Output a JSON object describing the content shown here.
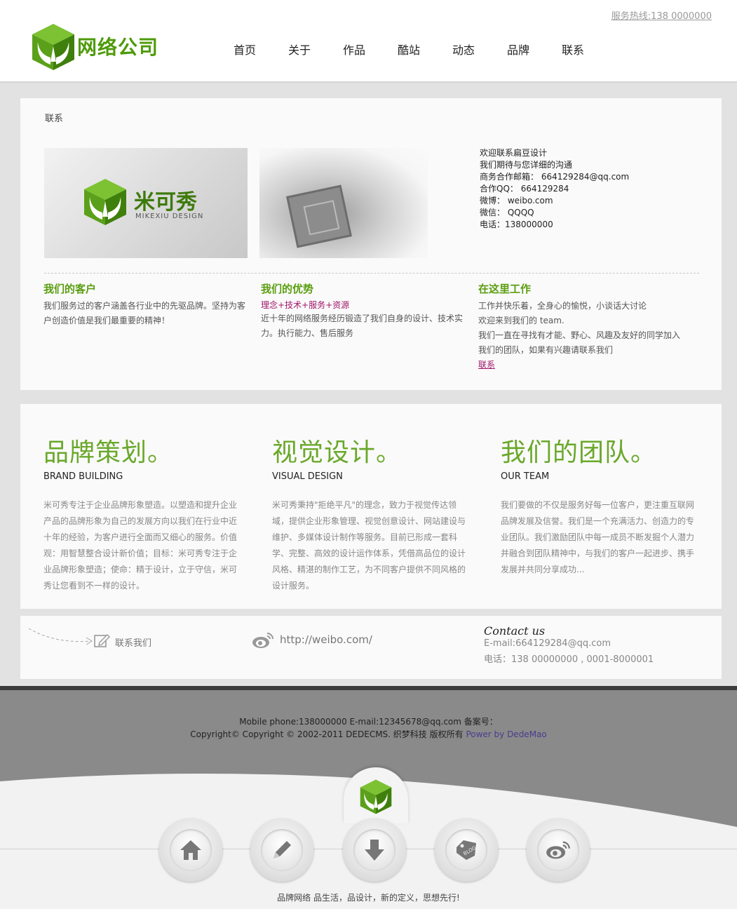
{
  "header": {
    "hotline": "服务热线:138 0000000",
    "logo_text": "网络公司",
    "nav": [
      "首页",
      "关于",
      "作品",
      "酷站",
      "动态",
      "品牌",
      "联系"
    ]
  },
  "contact": {
    "breadcrumb": "联系",
    "logo_name": "米可秀",
    "logo_sub": "MIKEXIU DESIGN",
    "info": [
      "欢迎联系扁豆设计",
      "我们期待与您详细的沟通",
      "商务合作邮箱： 664129284@qq.com",
      "合作QQ： 664129284",
      "微博： weibo.com",
      "微信： QQQQ",
      "电话：138000000"
    ],
    "col1": {
      "title": "我们的客户",
      "text": "我们服务过的客户涵盖各行业中的先驱品牌。坚持为客户创造价值是我们最重要的精神！"
    },
    "col2": {
      "title": "我们的优势",
      "highlight": "理念+技术+服务+资源",
      "text": "近十年的网络服务经历锻造了我们自身的设计、技术实力。执行能力、售后服务"
    },
    "col3": {
      "title": "在这里工作",
      "line1": "工作并快乐着，全身心的愉悦，小谈话大讨论",
      "line2": "欢迎来到我们的 team.",
      "line3": "我们一直在寻找有才能、野心、风趣及友好的同学加入我们的团队，如果有兴趣请联系我们",
      "link": "联系"
    }
  },
  "services": [
    {
      "title": "品牌策划。",
      "en": "BRAND BUILDING",
      "text": "米可秀专注于企业品牌形象塑造。以塑造和提升企业产品的品牌形象为自己的发展方向以我们在行业中近十年的经验，为客户进行全面而又细心的服务。价值观：用智慧整合设计新价值；目标：米可秀专注于企业品牌形象塑造；使命：精于设计，立于守信，米可秀让您看到不一样的设计。"
    },
    {
      "title": "视觉设计。",
      "en": "VISUAL DESIGN",
      "text": "米可秀秉持\"拒绝平凡\"的理念，致力于视觉传达领域，提供企业形象管理、视觉创意设计、网站建设与维护、多媒体设计制作等服务。目前已形成一套科学、完整、高效的设计运作体系，凭借高品位的设计风格、精湛的制作工艺，为不同客户提供不同风格的设计服务。"
    },
    {
      "title": "我们的团队。",
      "en": "OUR TEAM",
      "text": "我们要做的不仅是服务好每一位客户，更注重互联网品牌发展及信誉。我们是一个充满活力、创造力的专业团队。我们激励团队中每一成员不断发掘个人潜力并融合到团队精神中，与我们的客户一起进步、携手发展并共同分享成功..."
    }
  ],
  "strip": {
    "contact_link": "联系我们",
    "weibo_url": "http://weibo.com/",
    "contact_title": "Contact us",
    "email": "E-mail:664129284@qq.com",
    "phone": "电话：138 00000000 , 0001-8000001"
  },
  "footer": {
    "line1": "Mobile phone:138000000  E-mail:12345678@qq.com  备案号：",
    "line2": "Copyright© Copyright © 2002-2011 DEDECMS. 织梦科技 版权所有 ",
    "power": "Power by DedeMao",
    "icons": [
      "home-icon",
      "pencil-icon",
      "download-icon",
      "blog-tag-icon",
      "weibo-icon"
    ],
    "slogan": "品牌网络 品生活，品设计，新的定义，思想先行!"
  },
  "colors": {
    "brand_green": "#5a9e10",
    "accent_pink": "#a0156a",
    "footer_gray": "#8a8a8a"
  }
}
